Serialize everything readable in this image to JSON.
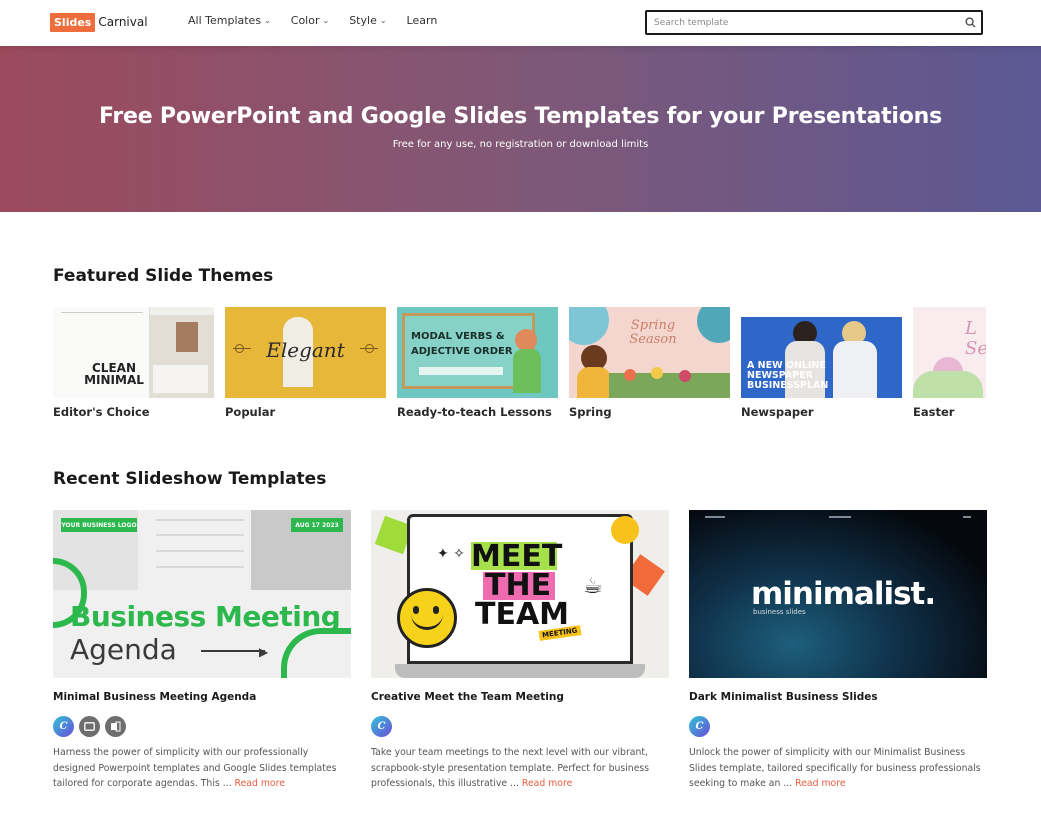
{
  "header": {
    "logo_box": "Slides",
    "logo_text": "Carnival",
    "nav": [
      {
        "label": "All Templates",
        "has_dropdown": true
      },
      {
        "label": "Color",
        "has_dropdown": true
      },
      {
        "label": "Style",
        "has_dropdown": true
      },
      {
        "label": "Learn",
        "has_dropdown": false
      }
    ],
    "search_placeholder": "Search template"
  },
  "hero": {
    "title": "Free PowerPoint and Google Slides Templates for your Presentations",
    "subtitle": "Free for any use, no registration or download limits"
  },
  "featured": {
    "title": "Featured Slide Themes",
    "themes": [
      {
        "label": "Editor's Choice",
        "thumb_text": "CLEAN MINIMAL"
      },
      {
        "label": "Popular",
        "thumb_text": "Elegant"
      },
      {
        "label": "Ready-to-teach Lessons",
        "thumb_text": "MODAL VERBS & ADJECTIVE ORDER"
      },
      {
        "label": "Spring",
        "thumb_text": "Spring Season"
      },
      {
        "label": "Newspaper",
        "thumb_text": "A NEW ONLINE NEWSPAPER BUSINESSPLAN"
      },
      {
        "label": "Easter",
        "thumb_text": "L Se"
      }
    ]
  },
  "recent": {
    "title": "Recent Slideshow Templates",
    "read_more": "Read more",
    "cards": [
      {
        "title": "Minimal Business Meeting Agenda",
        "thumb_line1": "Business Meeting",
        "thumb_line2": "Agenda",
        "thumb_logo": "YOUR BUSINESS LOGO",
        "thumb_date": "AUG 17 2023",
        "desc": "Harness the power of simplicity with our professionally designed Powerpoint templates and Google Slides templates tailored for corporate agendas. This ..."
      },
      {
        "title": "Creative Meet the Team Meeting",
        "thumb_line1": "MEET",
        "thumb_line2": "THE",
        "thumb_line3": "TEAM",
        "thumb_tag": "MEETING",
        "desc": "Take your team meetings to the next level with our vibrant, scrapbook-style presentation template. Perfect for business professionals, this illustrative ..."
      },
      {
        "title": "Dark Minimalist Business Slides",
        "thumb_line1": "minimalist.",
        "thumb_line2": "business slides",
        "desc": "Unlock the power of simplicity with our Minimalist Business Slides template, tailored specifically for business professionals seeking to make an ..."
      }
    ]
  },
  "colors": {
    "accent": "#ef6d3b",
    "read_more": "#e85c3d",
    "hero_left": "#9c4a5d",
    "hero_right": "#5b5893"
  }
}
